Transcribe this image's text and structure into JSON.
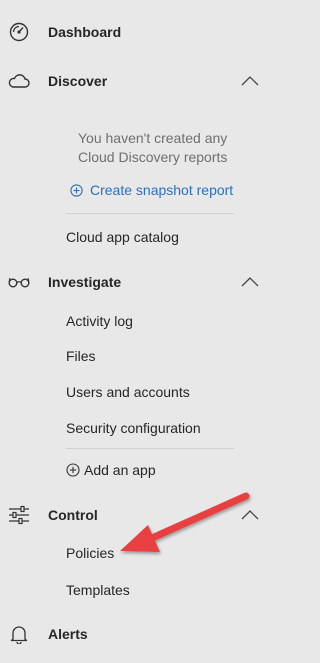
{
  "nav": {
    "dashboard": {
      "label": "Dashboard",
      "icon": "speedometer-icon"
    },
    "discover": {
      "label": "Discover",
      "icon": "cloud-icon",
      "empty_message_line1": "You haven't created any",
      "empty_message_line2": "Cloud Discovery reports",
      "create_snapshot_label": "Create snapshot report",
      "items": [
        "Cloud app catalog"
      ]
    },
    "investigate": {
      "label": "Investigate",
      "icon": "glasses-icon",
      "items": [
        "Activity log",
        "Files",
        "Users and accounts",
        "Security configuration"
      ],
      "add_app_label": "Add an app"
    },
    "control": {
      "label": "Control",
      "icon": "sliders-icon",
      "items": [
        "Policies",
        "Templates"
      ]
    },
    "alerts": {
      "label": "Alerts",
      "icon": "bell-icon"
    }
  },
  "colors": {
    "background": "#e8e8e8",
    "text": "#262626",
    "muted_text": "#6f6f6f",
    "link": "#2b6fc2",
    "annotation_arrow": "#e8403f"
  }
}
